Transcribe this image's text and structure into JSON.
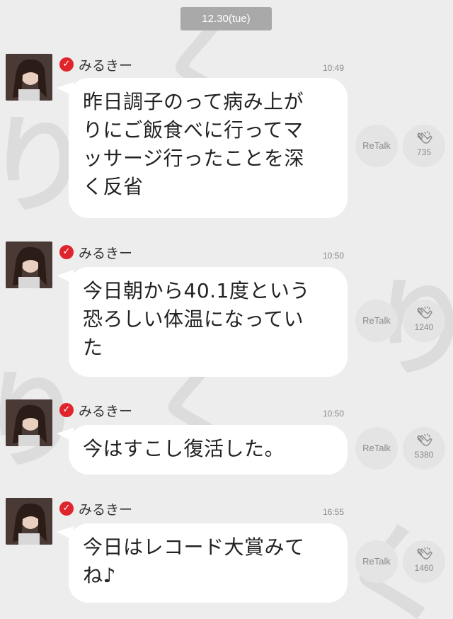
{
  "header": {
    "date": "12.30(tue)"
  },
  "colors": {
    "background": "#ededed",
    "verified": "#e0242c",
    "bubble": "#ffffff",
    "date_pill": "#a9a9a9"
  },
  "messages": [
    {
      "author": "みるきー",
      "time": "10:49",
      "text": "昨日調子のって病み上が\nりにご飯食べに行ってマ\nッサージ行ったことを深\nく反省",
      "retalk_label": "ReTalk",
      "clap_count": "735"
    },
    {
      "author": "みるきー",
      "time": "10:50",
      "text": "今日朝から40.1度という\n恐ろしい体温になってい\nた",
      "retalk_label": "ReTalk",
      "clap_count": "1240"
    },
    {
      "author": "みるきー",
      "time": "10:50",
      "text": "今はすこし復活した。",
      "retalk_label": "ReTalk",
      "clap_count": "5380"
    },
    {
      "author": "みるきー",
      "time": "16:55",
      "text": "今日はレコード大賞みて\nね♪",
      "retalk_label": "ReTalk",
      "clap_count": "1460"
    }
  ]
}
